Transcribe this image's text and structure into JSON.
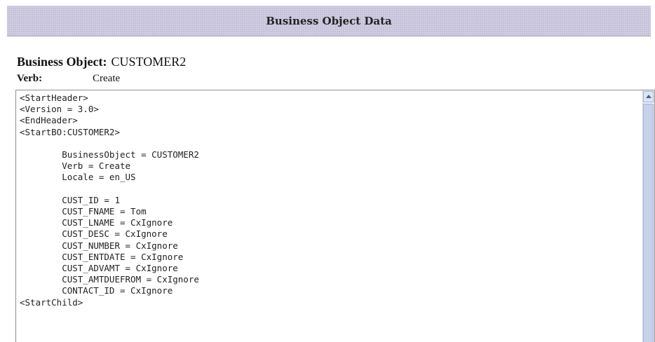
{
  "header": {
    "title": "Business Object Data"
  },
  "info": {
    "business_object_label": "Business Object:",
    "business_object_value": "CUSTOMER2",
    "verb_label": "Verb:",
    "verb_value": "Create"
  },
  "code": {
    "text": "<StartHeader>\n<Version = 3.0>\n<EndHeader>\n<StartBO:CUSTOMER2>\n\n        BusinessObject = CUSTOMER2\n        Verb = Create\n        Locale = en_US\n\n        CUST_ID = 1\n        CUST_FNAME = Tom\n        CUST_LNAME = CxIgnore\n        CUST_DESC = CxIgnore\n        CUST_NUMBER = CxIgnore\n        CUST_ENTDATE = CxIgnore\n        CUST_ADVAMT = CxIgnore\n        CUST_AMTDUEFROM = CxIgnore\n        CONTACT_ID = CxIgnore\n<StartChild>"
  },
  "icons": {
    "scroll_up": "chevron-up-icon"
  }
}
